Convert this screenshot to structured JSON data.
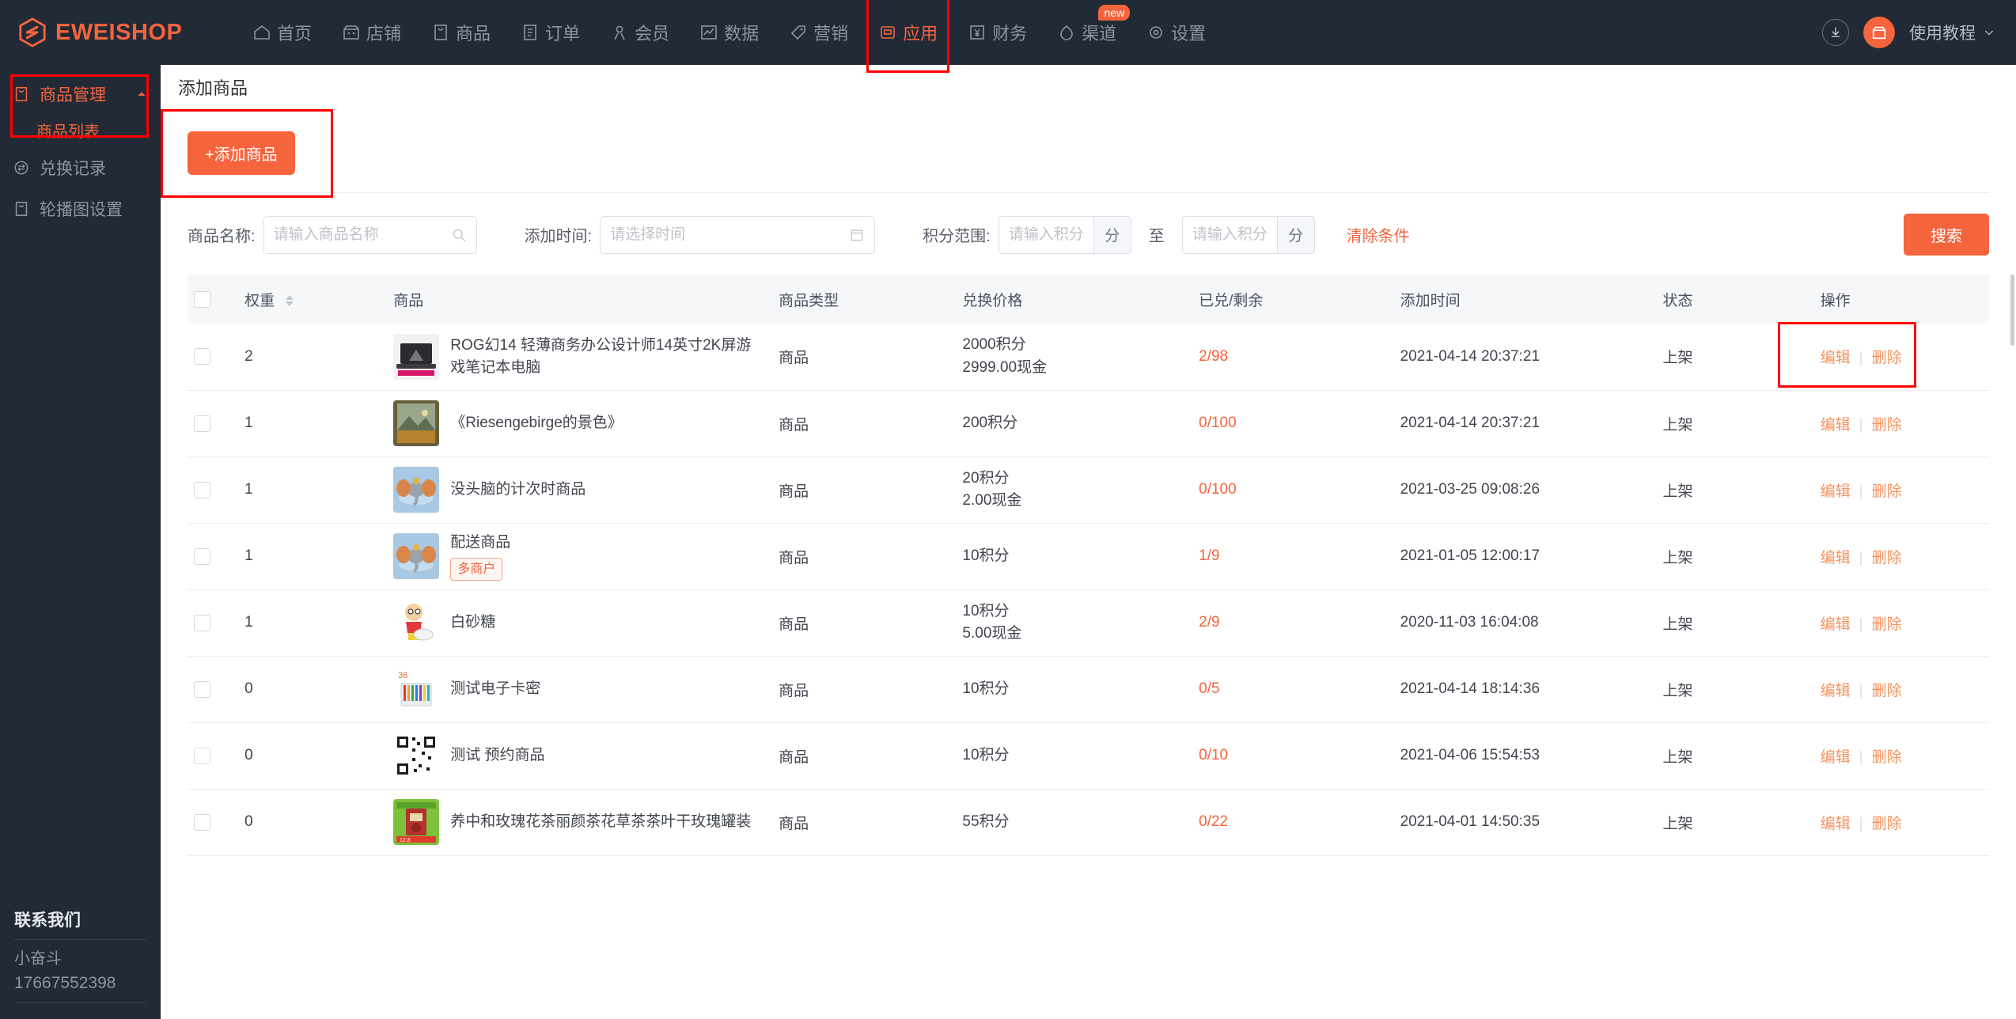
{
  "header": {
    "brand": "EWEISHOP",
    "nav": [
      {
        "label": "首页",
        "icon": "home-icon",
        "active": false
      },
      {
        "label": "店铺",
        "icon": "shop-icon",
        "active": false
      },
      {
        "label": "商品",
        "icon": "goods-icon",
        "active": false
      },
      {
        "label": "订单",
        "icon": "order-icon",
        "active": false
      },
      {
        "label": "会员",
        "icon": "member-icon",
        "active": false
      },
      {
        "label": "数据",
        "icon": "chart-icon",
        "active": false
      },
      {
        "label": "营销",
        "icon": "tag-icon",
        "active": false
      },
      {
        "label": "应用",
        "icon": "app-icon",
        "active": true
      },
      {
        "label": "财务",
        "icon": "finance-icon",
        "active": false
      },
      {
        "label": "渠道",
        "icon": "channel-icon",
        "active": false,
        "badge": "new"
      },
      {
        "label": "设置",
        "icon": "gear-icon",
        "active": false
      }
    ],
    "download_icon": "download-icon",
    "avatar_icon": "shop-avatar-icon",
    "tutorial_label": "使用教程",
    "tutorial_caret": "chevron-down-icon"
  },
  "sidebar": {
    "group": {
      "label": "商品管理",
      "icon": "goods-icon",
      "caret": "chevron-up-icon",
      "active": true
    },
    "sub_items": [
      {
        "label": "商品列表",
        "active": true
      }
    ],
    "items": [
      {
        "label": "兑换记录",
        "icon": "exchange-icon"
      },
      {
        "label": "轮播图设置",
        "icon": "banner-icon"
      }
    ],
    "contact": {
      "title": "联系我们",
      "name": "小奋斗",
      "phone": "17667552398"
    }
  },
  "page": {
    "title": "添加商品",
    "add_button": "+添加商品"
  },
  "filters": {
    "name_label": "商品名称:",
    "name_placeholder": "请输入商品名称",
    "name_value": "",
    "time_label": "添加时间:",
    "time_placeholder": "请选择时间",
    "time_value": "",
    "points_label": "积分范围:",
    "points_min_placeholder": "请输入积分下限",
    "points_min_value": "",
    "points_max_placeholder": "请输入积分上限",
    "points_max_value": "",
    "unit": "分",
    "between": "至",
    "clear_label": "清除条件",
    "search_label": "搜索"
  },
  "table": {
    "columns": [
      "权重",
      "商品",
      "商品类型",
      "兑换价格",
      "已兑/剩余",
      "添加时间",
      "状态",
      "操作"
    ],
    "actions": {
      "edit": "编辑",
      "delete": "删除"
    },
    "rows": [
      {
        "weight": "2",
        "name": "ROG幻14 轻薄商务办公设计师14英寸2K屏游戏笔记本电脑",
        "badge": "",
        "type": "商品",
        "price_points": "2000积分",
        "price_cash": "2999.00现金",
        "stock": "2/98",
        "time": "2021-04-14 20:37:21",
        "status": "上架",
        "thumb": "laptop-thumbnail"
      },
      {
        "weight": "1",
        "name": "《Riesengebirge的景色》",
        "badge": "",
        "type": "商品",
        "price_points": "200积分",
        "price_cash": "",
        "stock": "0/100",
        "time": "2021-04-14 20:37:21",
        "status": "上架",
        "thumb": "painting-thumbnail"
      },
      {
        "weight": "1",
        "name": "没头脑的计次时商品",
        "badge": "",
        "type": "商品",
        "price_points": "20积分",
        "price_cash": "2.00现金",
        "stock": "0/100",
        "time": "2021-03-25 09:08:26",
        "status": "上架",
        "thumb": "elephant-thumbnail"
      },
      {
        "weight": "1",
        "name": "配送商品",
        "badge": "多商户",
        "type": "商品",
        "price_points": "10积分",
        "price_cash": "",
        "stock": "1/9",
        "time": "2021-01-05 12:00:17",
        "status": "上架",
        "thumb": "elephant-thumbnail"
      },
      {
        "weight": "1",
        "name": "白砂糖",
        "badge": "",
        "type": "商品",
        "price_points": "10积分",
        "price_cash": "5.00现金",
        "stock": "2/9",
        "time": "2020-11-03 16:04:08",
        "status": "上架",
        "thumb": "cartoon-thumbnail"
      },
      {
        "weight": "0",
        "name": "测试电子卡密",
        "badge": "",
        "type": "商品",
        "price_points": "10积分",
        "price_cash": "",
        "stock": "0/5",
        "time": "2021-04-14 18:14:36",
        "status": "上架",
        "thumb": "pencils-thumbnail"
      },
      {
        "weight": "0",
        "name": "测试 预约商品",
        "badge": "",
        "type": "商品",
        "price_points": "10积分",
        "price_cash": "",
        "stock": "0/10",
        "time": "2021-04-06 15:54:53",
        "status": "上架",
        "thumb": "qrcode-thumbnail"
      },
      {
        "weight": "0",
        "name": "养中和玫瑰花茶丽颜茶花草茶茶叶干玫瑰罐装",
        "badge": "",
        "type": "商品",
        "price_points": "55积分",
        "price_cash": "",
        "stock": "0/22",
        "time": "2021-04-01 14:50:35",
        "status": "上架",
        "thumb": "tea-thumbnail"
      }
    ]
  },
  "colors": {
    "accent": "#f4643d",
    "header_bg": "#222a35",
    "highlight_box": "#ff0000",
    "link": "#f4925f"
  }
}
